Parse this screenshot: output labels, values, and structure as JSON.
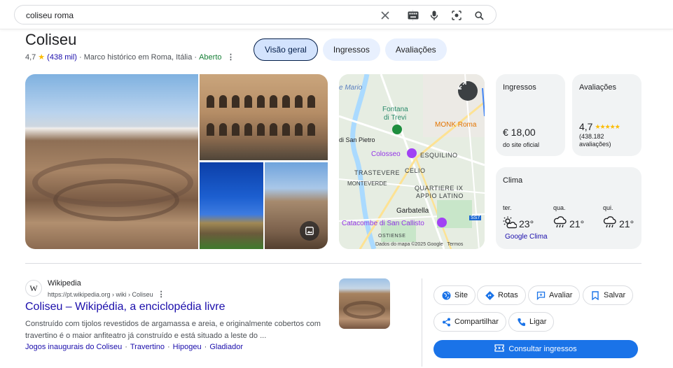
{
  "search": {
    "query": "coliseu roma"
  },
  "entity": {
    "title": "Coliseu",
    "rating": "4,7",
    "reviews_count": "(438 mil)",
    "category": "· Marco histórico em Roma, Itália ·",
    "status": "Aberto"
  },
  "tabs": [
    {
      "label": "Visão geral",
      "active": true
    },
    {
      "label": "Ingressos",
      "active": false
    },
    {
      "label": "Avaliações",
      "active": false
    }
  ],
  "map": {
    "labels": {
      "mario": "e Mario",
      "fontana": "Fontana",
      "di_trevi": "di Trevi",
      "monk_roma": "MONK Roma",
      "san_pietro": "di San Pietro",
      "colosseo": "Colosseo",
      "esquilino": "ESQUILINO",
      "trastevere": "TRASTEVERE",
      "celio": "CELIO",
      "monteverde": "MONTEVERDE",
      "quartiere_ix": "QUARTIERE IX",
      "appio_latino": "APPIO LATINO",
      "garbatella": "Garbatella",
      "catacombe": "Catacombe di San Callisto",
      "ostiense": "OSTIENSE",
      "ss7": "SS7"
    },
    "credits": "Dados do mapa ©2025 Google",
    "terms": "Termos"
  },
  "cards": {
    "ingressos": {
      "title": "Ingressos",
      "price": "€ 18,00",
      "source": "do site oficial"
    },
    "avaliacoes": {
      "title": "Avaliações",
      "rating": "4,7",
      "stars": "★★★★★",
      "count": "(438.182 avaliações)"
    },
    "clima": {
      "title": "Clima",
      "days": [
        {
          "day": "ter.",
          "temp": "23°",
          "icon": "partly-sunny-icon"
        },
        {
          "day": "qua.",
          "temp": "21°",
          "icon": "rain-cloud-icon"
        },
        {
          "day": "qui.",
          "temp": "21°",
          "icon": "rain-cloud-icon"
        }
      ],
      "link": "Google Clima"
    }
  },
  "result": {
    "site_name": "Wikipedia",
    "url": "https://pt.wikipedia.org › wiki › Coliseu",
    "title": "Coliseu – Wikipédia, a enciclopédia livre",
    "snippet": "Construído com tijolos revestidos de argamassa e areia, e originalmente cobertos com travertino é o maior anfiteatro já construído e está situado a leste do ...",
    "sitelinks": [
      "Jogos inaugurais do Coliseu",
      "Travertino",
      "Hipogeu",
      "Gladiador"
    ]
  },
  "actions": {
    "site": "Site",
    "rotas": "Rotas",
    "avaliar": "Avaliar",
    "salvar": "Salvar",
    "compartilhar": "Compartilhar",
    "ligar": "Ligar",
    "consultar": "Consultar ingressos"
  },
  "colors": {
    "link": "#1a0dab",
    "primary": "#1a73e8",
    "open": "#188038",
    "star": "#fbbc04"
  }
}
